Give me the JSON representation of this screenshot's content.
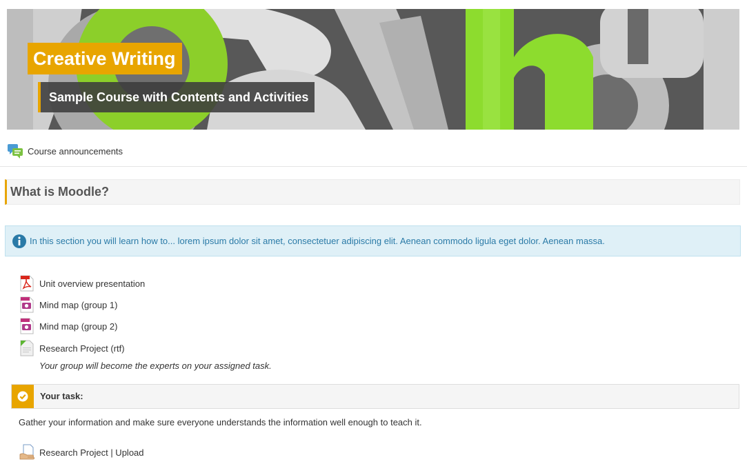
{
  "banner": {
    "title": "Creative Writing",
    "subtitle": "Sample Course with Contents and Activities",
    "accent_color": "#e8a500"
  },
  "announcements": {
    "icon": "forum-icon",
    "label": "Course announcements"
  },
  "section": {
    "title": "What is Moodle?"
  },
  "info": {
    "icon": "info-icon",
    "text": "In this section you will learn how to... lorem ipsum dolor sit amet, consectetuer adipiscing elit. Aenean commodo ligula eget dolor. Aenean massa."
  },
  "activities": [
    {
      "icon": "pdf-icon",
      "label": "Unit overview presentation"
    },
    {
      "icon": "image-file-icon",
      "label": "Mind map (group 1)"
    },
    {
      "icon": "image-file-icon",
      "label": "Mind map (group 2)"
    },
    {
      "icon": "document-icon",
      "label": "Research Project (rtf)"
    }
  ],
  "activity_description": "Your group will become the experts on your assigned task.",
  "task": {
    "icon": "check-circle-icon",
    "label": "Your task:",
    "text": "Gather your information and make sure everyone understands the information well enough to teach it."
  },
  "upload": {
    "icon": "assignment-icon",
    "label": "Research Project | Upload"
  }
}
